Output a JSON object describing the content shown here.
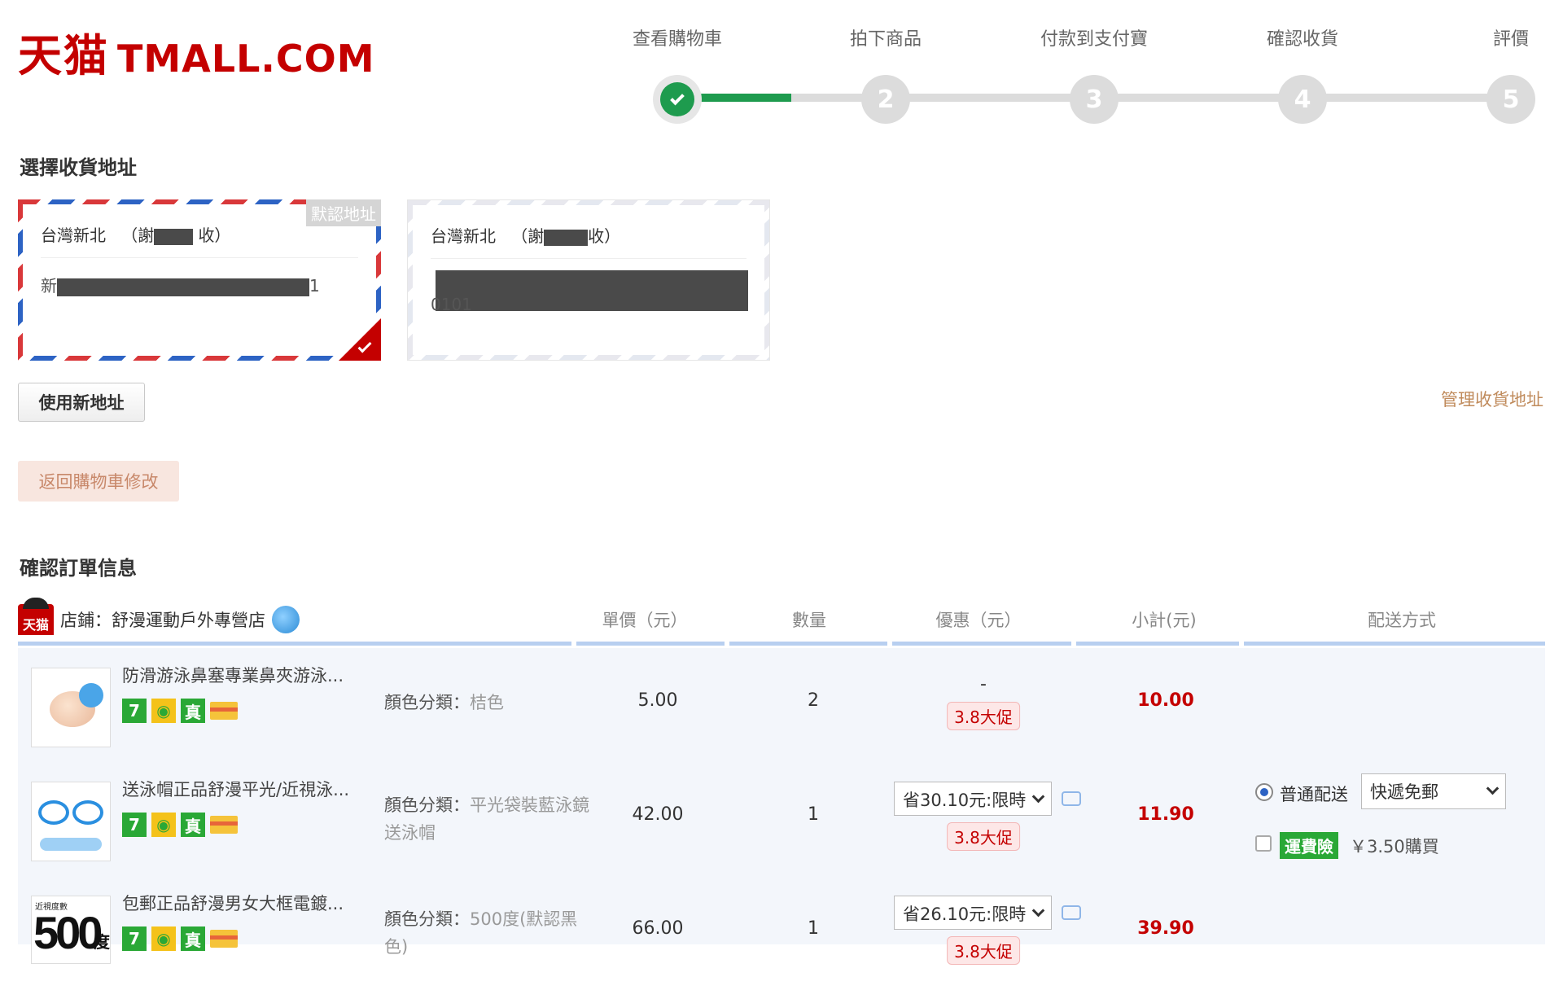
{
  "logo": {
    "cn": "天猫",
    "en": "TMALL.COM"
  },
  "steps": [
    {
      "label": "查看購物車",
      "number": "",
      "status": "done"
    },
    {
      "label": "拍下商品",
      "number": "2",
      "status": "pending"
    },
    {
      "label": "付款到支付寶",
      "number": "3",
      "status": "pending"
    },
    {
      "label": "確認收貨",
      "number": "4",
      "status": "pending"
    },
    {
      "label": "評價",
      "number": "5",
      "status": "pending"
    }
  ],
  "address_section": {
    "title": "選擇收貨地址",
    "cards": [
      {
        "region": "台灣新北",
        "recipient_prefix": "（謝",
        "recipient_suffix": "收）",
        "detail_prefix": "新",
        "detail_suffix": "1",
        "default_tag": "默認地址",
        "selected": true
      },
      {
        "region": "台灣新北",
        "recipient_prefix": "（謝",
        "recipient_suffix": "收）",
        "detail_prefix": "",
        "detail_suffix": "0101",
        "selected": false
      }
    ],
    "new_address_button": "使用新地址",
    "manage_link": "管理收貨地址",
    "back_to_cart_button": "返回購物車修改"
  },
  "order_section": {
    "title": "確認訂單信息",
    "shop_logo": "天猫",
    "shop_label": "店鋪：舒漫運動戶外專營店",
    "columns": {
      "price": "單價（元）",
      "quantity": "數量",
      "discount": "優惠（元）",
      "subtotal": "小計(元)",
      "shipping": "配送方式"
    },
    "badges": [
      "7",
      "",
      "真",
      ""
    ],
    "items": [
      {
        "title": "防滑游泳鼻塞專業鼻夾游泳...",
        "attr_label": "顏色分類：",
        "attr_value": "桔色",
        "price": "5.00",
        "quantity": "2",
        "discount_text": "-",
        "discount_select": "",
        "promo": "3.8大促",
        "subtotal": "10.00"
      },
      {
        "title": "送泳帽正品舒漫平光/近視泳...",
        "attr_label": "顏色分類：",
        "attr_value": "平光袋裝藍泳鏡送泳帽",
        "price": "42.00",
        "quantity": "1",
        "discount_text": "",
        "discount_select": "省30.10元:限時",
        "promo": "3.8大促",
        "subtotal": "11.90"
      },
      {
        "title": "包郵正品舒漫男女大框電鍍...",
        "attr_label": "顏色分類：",
        "attr_value": "500度(默認黑色)",
        "price": "66.00",
        "quantity": "1",
        "discount_text": "",
        "discount_select": "省26.10元:限時",
        "promo": "3.8大促",
        "subtotal": "39.90",
        "thumb_text": "500",
        "thumb_unit": "度",
        "thumb_caption": "近視度數"
      }
    ],
    "shipping": {
      "option_label": "普通配送",
      "method_select": "快遞免郵",
      "insurance_tag": "運費險",
      "insurance_price": "￥3.50購買"
    }
  },
  "colors": {
    "brand": "#c40000",
    "progress": "#1e9b4e",
    "link": "#c08b5c"
  }
}
